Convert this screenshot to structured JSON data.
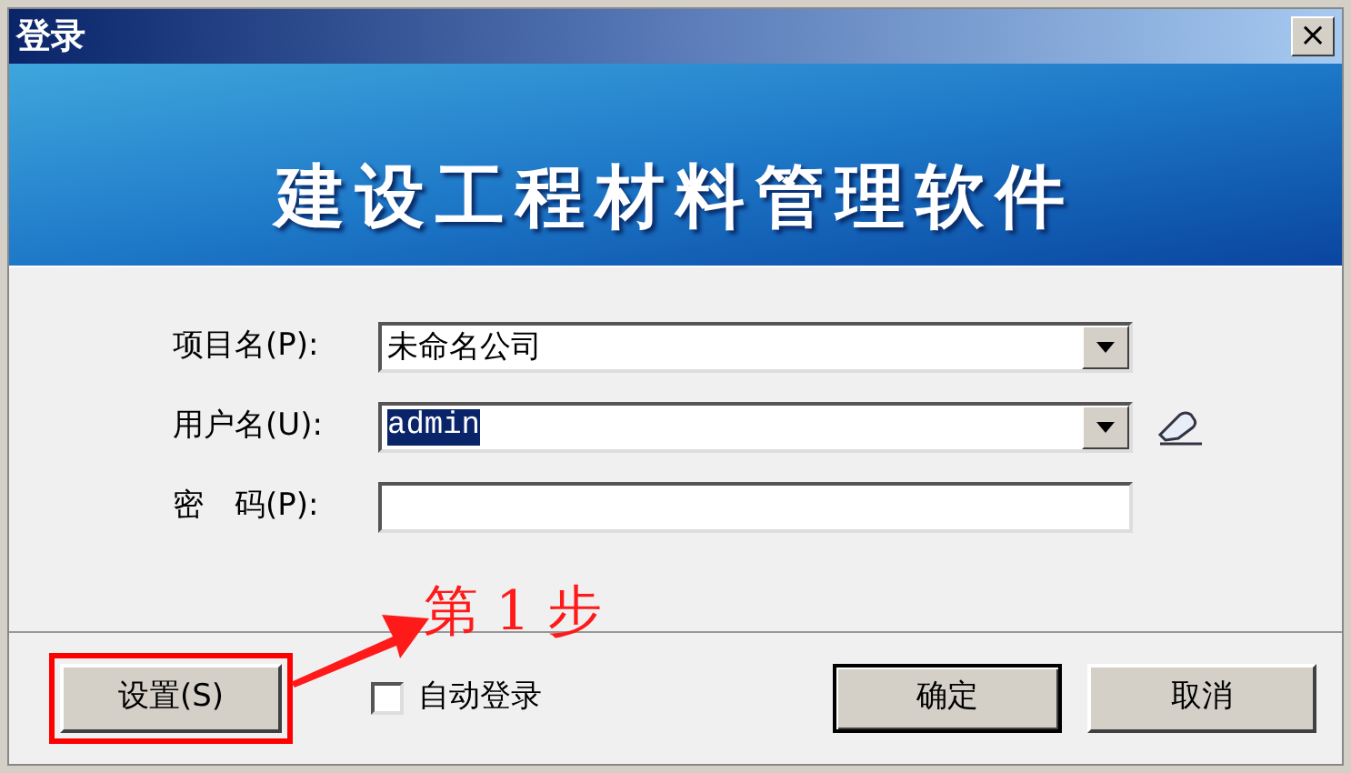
{
  "window": {
    "title": "登录",
    "close": "×"
  },
  "banner": {
    "title": "建设工程材料管理软件"
  },
  "fields": [
    {
      "kind": "combo",
      "label": "项目名(P):",
      "value": "未命名公司",
      "selected_text": false,
      "clear_icon": false
    },
    {
      "kind": "combo",
      "label": "用户名(U):",
      "value": "admin",
      "selected_text": true,
      "clear_icon": true
    },
    {
      "kind": "password",
      "label": "密　码(P):"
    }
  ],
  "settings_button": {
    "label": "设置(S)",
    "highlighted": true
  },
  "auto_login": {
    "label": "自动登录",
    "checked": false
  },
  "buttons": [
    {
      "label": "确定",
      "default": true
    },
    {
      "label": "取消",
      "default": false
    }
  ],
  "annotation": {
    "text": "第 1 步"
  }
}
